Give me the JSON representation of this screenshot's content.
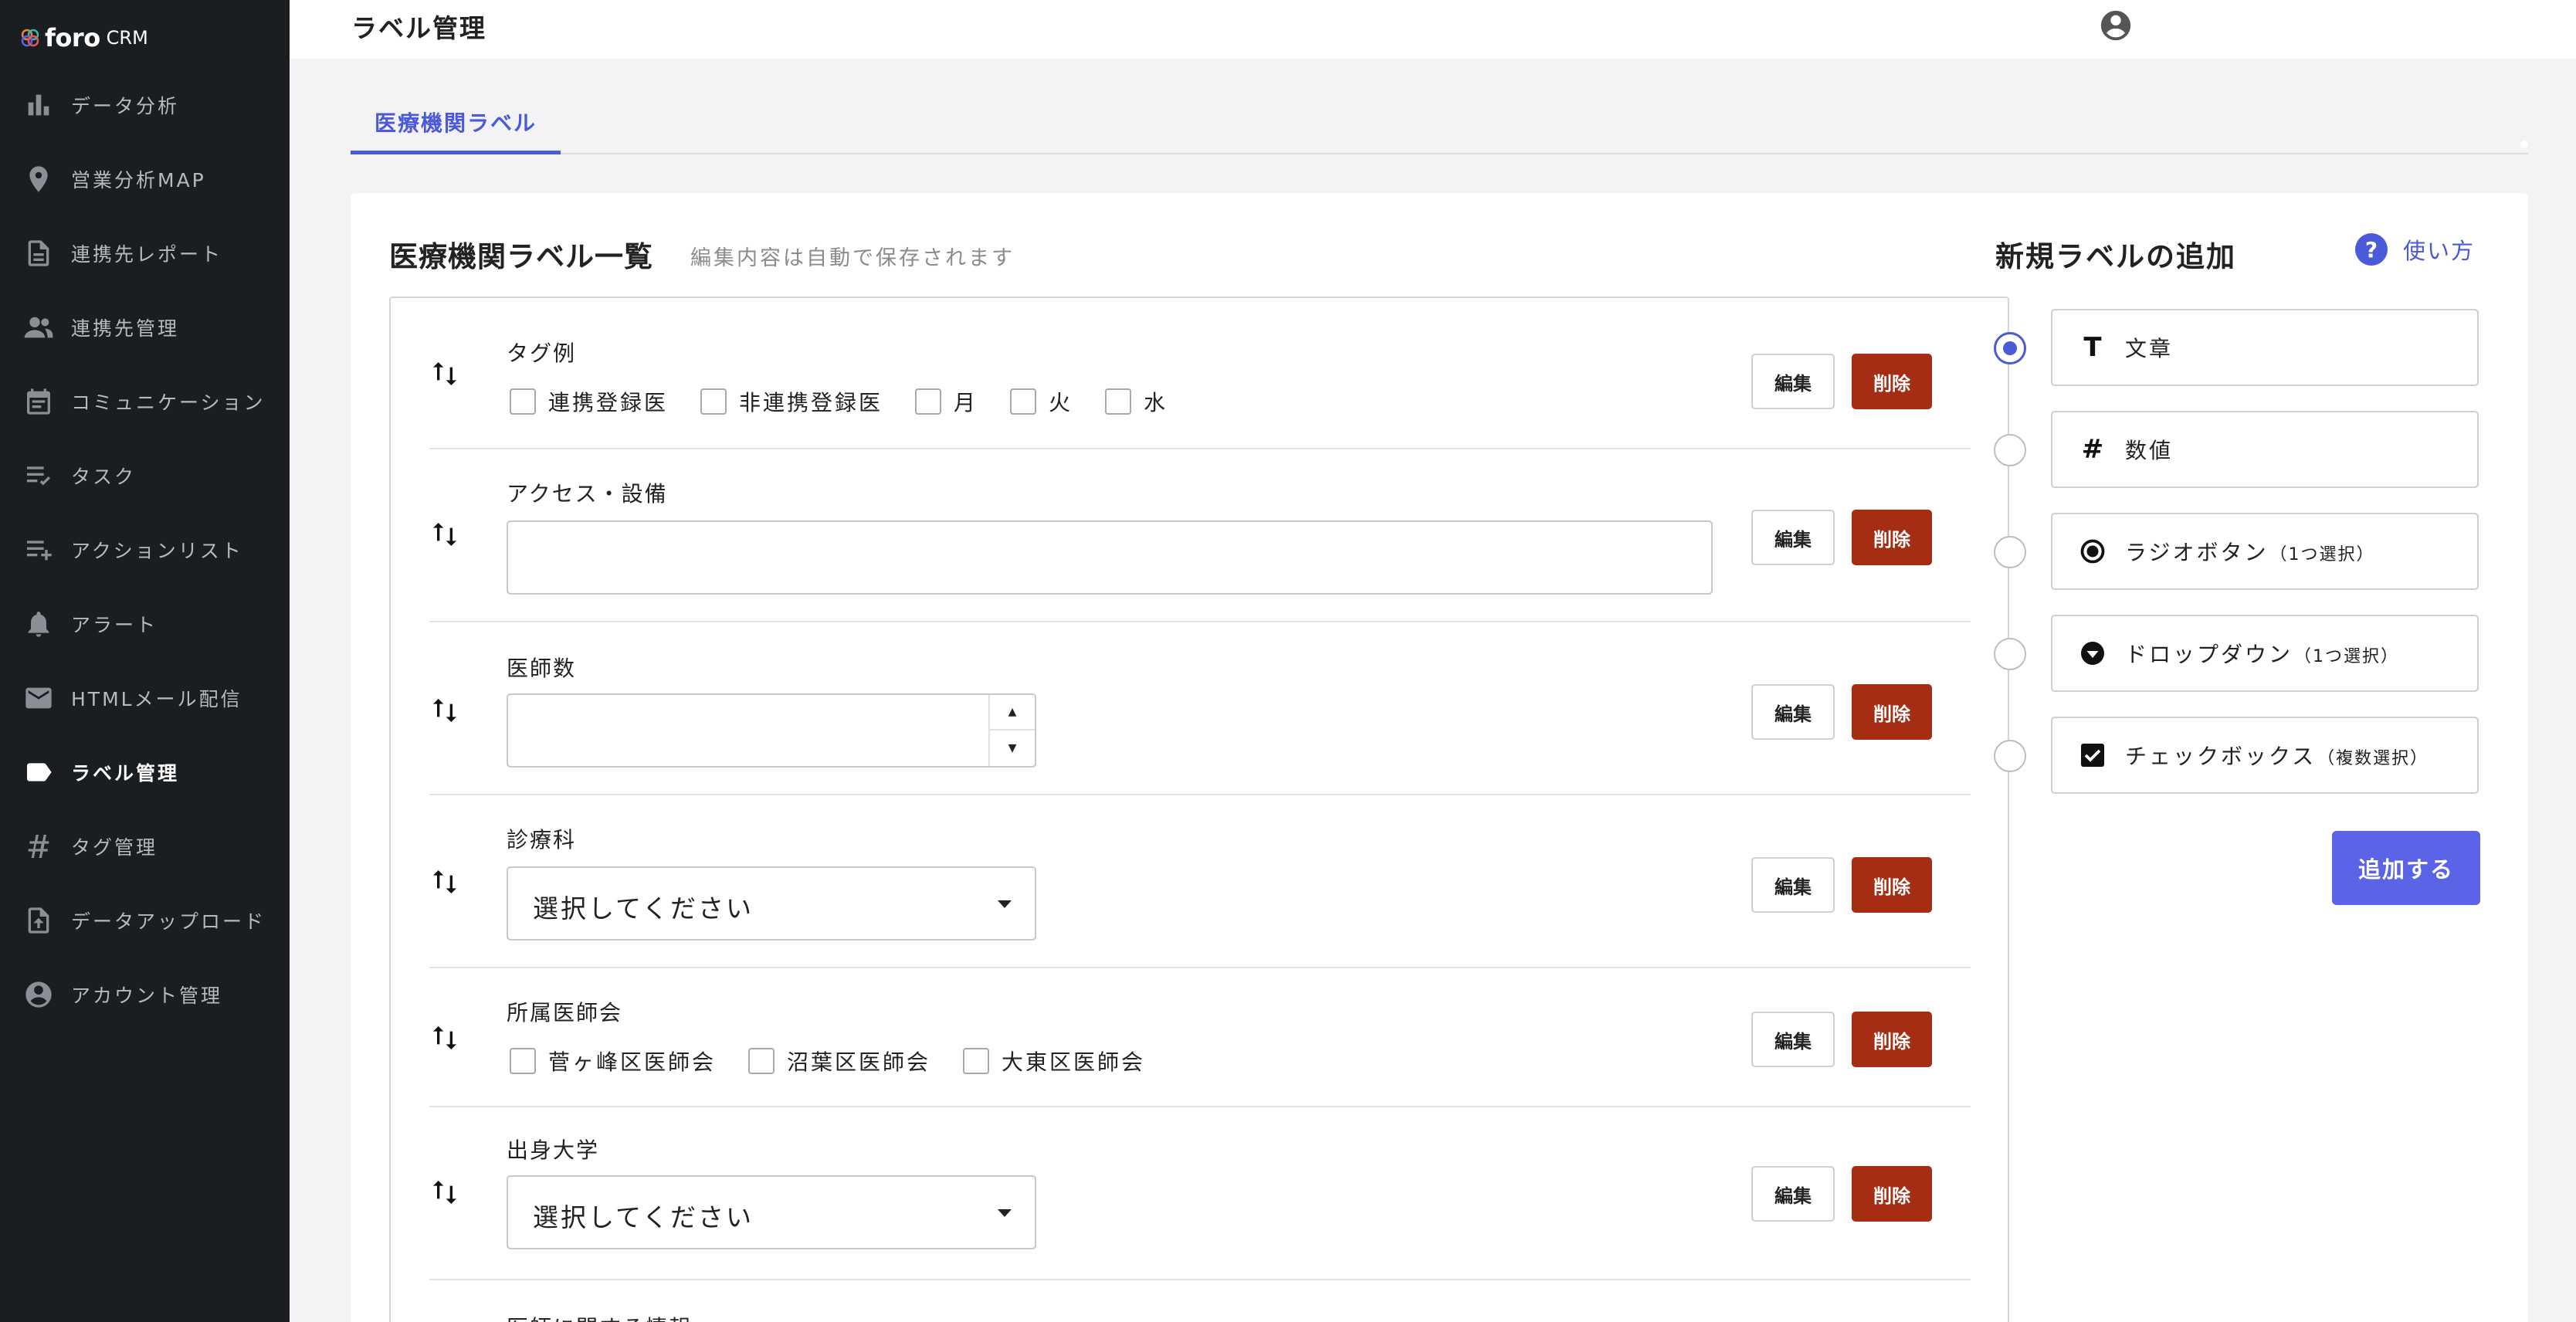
{
  "app": {
    "logo_foro": "foro",
    "logo_crm": "CRM"
  },
  "sidebar": {
    "items": [
      {
        "label": "データ分析",
        "icon": "bar-chart-icon"
      },
      {
        "label": "営業分析MAP",
        "icon": "map-pin-icon"
      },
      {
        "label": "連携先レポート",
        "icon": "document-icon"
      },
      {
        "label": "連携先管理",
        "icon": "people-icon"
      },
      {
        "label": "コミュニケーション",
        "icon": "calendar-note-icon"
      },
      {
        "label": "タスク",
        "icon": "checklist-icon"
      },
      {
        "label": "アクションリスト",
        "icon": "playlist-add-icon"
      },
      {
        "label": "アラート",
        "icon": "bell-icon"
      },
      {
        "label": "HTMLメール配信",
        "icon": "mail-icon"
      },
      {
        "label": "ラベル管理",
        "icon": "label-icon",
        "active": true
      },
      {
        "label": "タグ管理",
        "icon": "hash-icon"
      },
      {
        "label": "データアップロード",
        "icon": "file-upload-icon"
      },
      {
        "label": "アカウント管理",
        "icon": "account-circle-icon"
      }
    ]
  },
  "header": {
    "title": "ラベル管理",
    "account_icon": "account-circle-icon"
  },
  "tabs": [
    {
      "label": "医療機関ラベル",
      "active": true
    }
  ],
  "list": {
    "title": "医療機関ラベル一覧",
    "subtitle": "編集内容は自動で保存されます",
    "edit_label": "編集",
    "delete_label": "削除",
    "rows": [
      {
        "label": "タグ例",
        "type": "checkbox",
        "options": [
          "連携登録医",
          "非連携登録医",
          "月",
          "火",
          "水"
        ]
      },
      {
        "label": "アクセス・設備",
        "type": "text",
        "value": ""
      },
      {
        "label": "医師数",
        "type": "number",
        "value": ""
      },
      {
        "label": "診療科",
        "type": "dropdown",
        "placeholder": "選択してください"
      },
      {
        "label": "所属医師会",
        "type": "checkbox",
        "options": [
          "菅ヶ峰区医師会",
          "沼葉区医師会",
          "大東区医師会"
        ]
      },
      {
        "label": "出身大学",
        "type": "dropdown",
        "placeholder": "選択してください"
      },
      {
        "label": "医師に関する情報",
        "type": "partial"
      }
    ]
  },
  "add_panel": {
    "title": "新規ラベルの追加",
    "help_label": "使い方",
    "types": [
      {
        "label": "文章",
        "sub": "",
        "icon": "text-T-icon",
        "selected": true
      },
      {
        "label": "数値",
        "sub": "",
        "icon": "hash-icon",
        "selected": false
      },
      {
        "label": "ラジオボタン",
        "sub": "（1つ選択）",
        "icon": "radio-icon",
        "selected": false
      },
      {
        "label": "ドロップダウン",
        "sub": "（1つ選択）",
        "icon": "dropdown-circle-icon",
        "selected": false
      },
      {
        "label": "チェックボックス",
        "sub": "（複数選択）",
        "icon": "checkbox-checked-icon",
        "selected": false
      }
    ],
    "add_button": "追加する"
  },
  "colors": {
    "accent": "#4a5ad9",
    "delete": "#a52d13",
    "sidebar_bg": "#1b1e21",
    "add_button": "#5b63e6"
  }
}
